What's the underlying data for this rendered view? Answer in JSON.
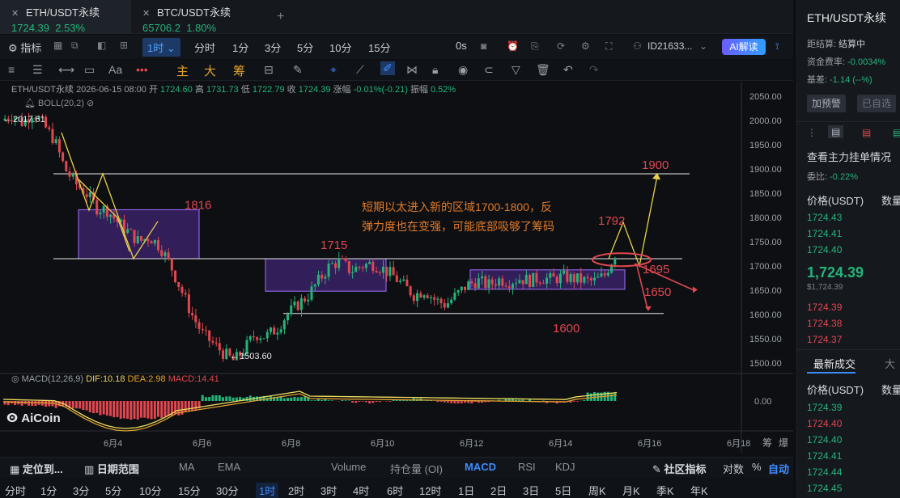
{
  "tabs": [
    {
      "symbol": "ETH/USDT永续",
      "price": "1724.39",
      "change": "2.53%",
      "active": true
    },
    {
      "symbol": "BTC/USDT永续",
      "price": "65706.2",
      "change": "1.80%",
      "active": false
    }
  ],
  "toolbar": {
    "indicator_label": "指标",
    "current_interval": "1时",
    "intervals": [
      "分时",
      "1分",
      "3分",
      "5分",
      "10分",
      "15分"
    ],
    "seconds": "0s",
    "account_id": "ID21633...",
    "ai_label": "AI解读"
  },
  "draw_tools": [
    "主",
    "大",
    "筹"
  ],
  "chart_info": {
    "symbol": "ETH/USDT永续",
    "datetime": "2026-06-15 08:00",
    "open_label": "开",
    "open": "1724.60",
    "high_label": "高",
    "high": "1731.73",
    "low_label": "低",
    "low": "1722.79",
    "close_label": "收",
    "close": "1724.39",
    "change_label": "涨幅",
    "change": "-0.01%(-0.21)",
    "amp_label": "振幅",
    "amp": "0.52%",
    "boll": "BOLL(20,2)"
  },
  "chart_data": {
    "type": "line",
    "price_axis": [
      "2050.00",
      "2000.00",
      "1950.00",
      "1900.00",
      "1850.00",
      "1800.00",
      "1750.00",
      "1700.00",
      "1650.00",
      "1600.00",
      "1550.00",
      "1500.00"
    ],
    "ylim": [
      1480,
      2070
    ],
    "x_labels": [
      "6月4",
      "6月6",
      "6月8",
      "6月10",
      "6月12",
      "6月14",
      "6月16",
      "6月18"
    ],
    "high_marker": "2017.61",
    "low_marker": "1503.60",
    "price_path": [
      2000,
      2012,
      1995,
      2017.61,
      1990,
      1960,
      1900,
      1870,
      1850,
      1820,
      1815,
      1790,
      1770,
      1750,
      1760,
      1740,
      1700,
      1650,
      1600,
      1560,
      1540,
      1520,
      1503.6,
      1530,
      1560,
      1555,
      1570,
      1600,
      1620,
      1640,
      1670,
      1700,
      1710,
      1690,
      1700,
      1705,
      1695,
      1680,
      1660,
      1640,
      1650,
      1630,
      1620,
      1640,
      1660,
      1670,
      1660,
      1672,
      1668,
      1674,
      1670,
      1676,
      1672,
      1678,
      1674,
      1670,
      1668,
      1680,
      1724.39
    ],
    "annotations": {
      "level_1816": "1816",
      "level_1715": "1715",
      "level_1900": "1900",
      "level_1792": "1792",
      "level_1695": "1695",
      "level_1650": "1650",
      "level_1600": "1600",
      "note": "短期以太进入新的区域1700-1800，反弹力度也在变强，可能底部吸够了筹码"
    },
    "h_lines": [
      1890,
      1715,
      1602
    ],
    "macd": {
      "label": "MACD(12,26,9)",
      "dif_label": "DIF:",
      "dif": "10.18",
      "dea_label": "DEA:",
      "dea": "2.98",
      "macd_label": "MACD:",
      "macd": "14.41",
      "axis": "0.00"
    }
  },
  "logo": "AiCoin",
  "bottom_indicators": {
    "locate": "定位到...",
    "range": "日期范围",
    "items": [
      "MA",
      "EMA",
      "Volume",
      "持仓量 (OI)",
      "MACD",
      "RSI",
      "KDJ"
    ],
    "active": "MACD",
    "community": "社区指标",
    "log": "对数",
    "pct": "%",
    "auto": "自动"
  },
  "timeframes": [
    "分时",
    "1分",
    "3分",
    "5分",
    "10分",
    "15分",
    "30分",
    "1时",
    "2时",
    "3时",
    "4时",
    "6时",
    "12时",
    "1日",
    "2日",
    "3日",
    "5日",
    "周K",
    "月K",
    "季K",
    "年K"
  ],
  "active_timeframe": "1时",
  "axis_extra": [
    "筹",
    "爆"
  ],
  "right_panel": {
    "title": "ETH/USDT永续",
    "settle_label": "距结算:",
    "settle_value": "结算中",
    "funding_label": "资金费率:",
    "funding_value": "-0.0034%",
    "basis_label": "基差:",
    "basis_value": "-1.14 (--%)",
    "alert_btn": "加预警",
    "selected_btn": "已自选",
    "orderbook_title": "查看主力挂单情况",
    "ratio_label": "委比:",
    "ratio_value": "-0.22%",
    "price_header": "价格(USDT)",
    "qty_header": "数量",
    "bids": [
      "1724.43",
      "1724.41",
      "1724.40"
    ],
    "last_price": "1,724.39",
    "last_price_sub": "$1,724.39",
    "asks": [
      "1724.39",
      "1724.38",
      "1724.37"
    ],
    "trades_tab": "最新成交",
    "trades_tab2": "大",
    "trades": [
      "1724.39",
      "1724.40",
      "1724.40",
      "1724.41",
      "1724.44",
      "1724.45"
    ]
  }
}
